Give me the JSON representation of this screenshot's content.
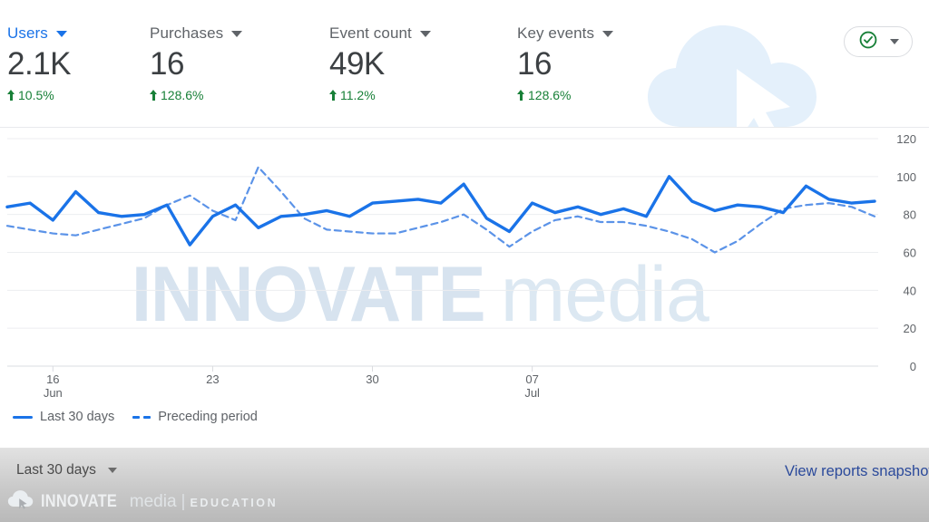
{
  "metrics": [
    {
      "label": "Users",
      "value": "2.1K",
      "delta": "10.5%",
      "trend": "up",
      "active": true,
      "icon": "chevron-down-icon"
    },
    {
      "label": "Purchases",
      "value": "16",
      "delta": "128.6%",
      "trend": "up",
      "active": false,
      "icon": "chevron-down-icon"
    },
    {
      "label": "Event count",
      "value": "49K",
      "delta": "11.2%",
      "trend": "up",
      "active": false,
      "icon": "chevron-down-icon"
    },
    {
      "label": "Key events",
      "value": "16",
      "delta": "128.6%",
      "trend": "up",
      "active": false,
      "icon": "chevron-down-icon"
    }
  ],
  "status_badge": {
    "icon": "check-circle-icon",
    "caret_icon": "chevron-down-icon",
    "color": "#188038"
  },
  "legend": [
    {
      "label": "Last 30 days",
      "style": "solid",
      "color": "#1a73e8"
    },
    {
      "label": "Preceding period",
      "style": "dashed",
      "color": "#4285f4"
    }
  ],
  "footer": {
    "date_range": "Last 30 days",
    "date_caret_icon": "chevron-down-icon",
    "link": "View reports snapshot"
  },
  "watermark": {
    "brand_bold": "INNOVATE",
    "brand_light": "media",
    "separator": "|",
    "tagline": "EDUCATION",
    "cloud_icon": "cloud-cursor-icon"
  },
  "chart_data": {
    "type": "line",
    "title": "",
    "xlabel": "",
    "ylabel": "",
    "ylim": [
      0,
      120
    ],
    "yticks": [
      0,
      20,
      40,
      60,
      80,
      100,
      120
    ],
    "grid": true,
    "legend_position": "bottom-left",
    "xticks": [
      {
        "pos": 2,
        "label": "16",
        "sublabel": "Jun"
      },
      {
        "pos": 9,
        "label": "23",
        "sublabel": ""
      },
      {
        "pos": 16,
        "label": "30",
        "sublabel": ""
      },
      {
        "pos": 23,
        "label": "07",
        "sublabel": "Jul"
      }
    ],
    "series": [
      {
        "name": "Last 30 days",
        "style": "solid",
        "color": "#1a73e8",
        "values": [
          84,
          86,
          77,
          92,
          81,
          79,
          80,
          85,
          64,
          79,
          85,
          73,
          79,
          80,
          82,
          79,
          86,
          87,
          88,
          86,
          96,
          78,
          71,
          86,
          81,
          84,
          80,
          83,
          79,
          100,
          87,
          82,
          85,
          84,
          81,
          95,
          88,
          86,
          87
        ]
      },
      {
        "name": "Preceding period",
        "style": "dashed",
        "color": "#5b93e8",
        "values": [
          74,
          72,
          70,
          69,
          72,
          75,
          78,
          85,
          90,
          82,
          77,
          105,
          92,
          78,
          72,
          71,
          70,
          70,
          73,
          76,
          80,
          72,
          63,
          71,
          77,
          79,
          76,
          76,
          74,
          71,
          67,
          60,
          66,
          75,
          83,
          85,
          86,
          84,
          79
        ]
      }
    ]
  }
}
